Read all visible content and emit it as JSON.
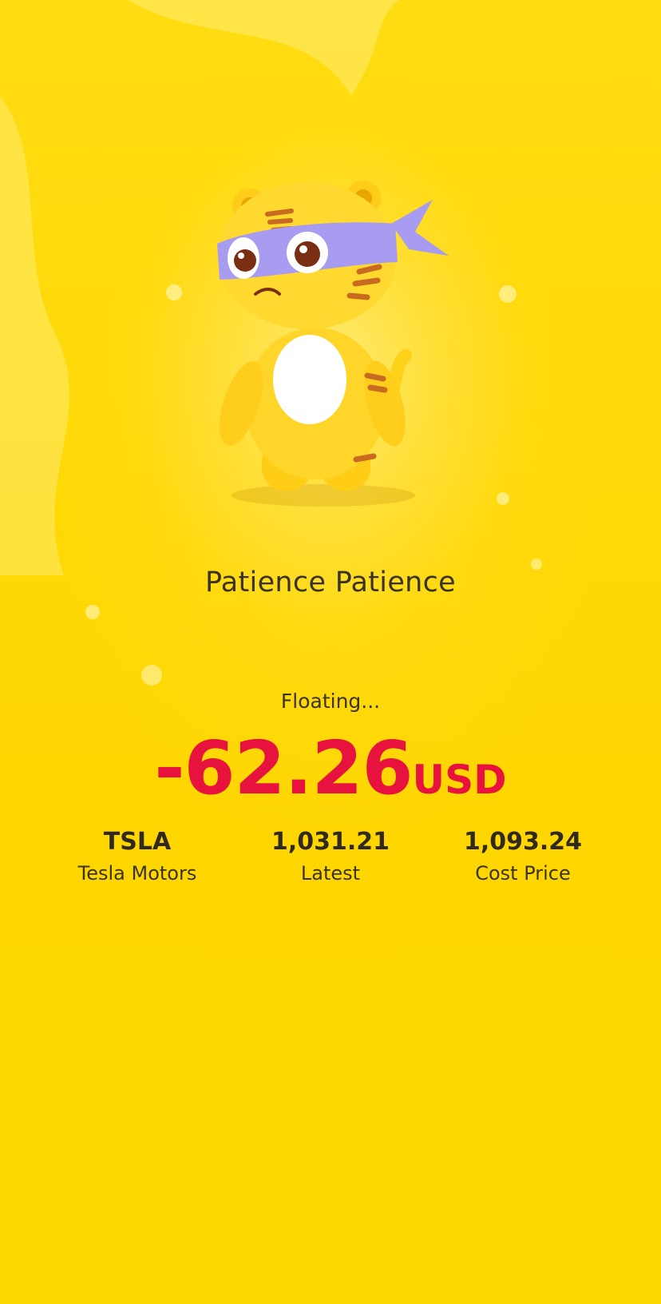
{
  "mascot": {
    "icon": "tiger-mascot-icon"
  },
  "title": "Patience Patience",
  "status": "Floating...",
  "pnl": {
    "value": "-62.26",
    "currency": "USD",
    "color": "#E8123E"
  },
  "stats": {
    "symbol": {
      "value": "TSLA",
      "label": "Tesla Motors"
    },
    "latest": {
      "value": "1,031.21",
      "label": "Latest"
    },
    "cost": {
      "value": "1,093.24",
      "label": "Cost Price"
    }
  },
  "colors": {
    "background": "#FFD500",
    "text": "#3a3320"
  }
}
